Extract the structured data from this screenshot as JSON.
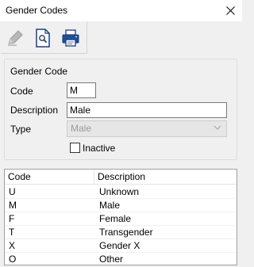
{
  "window": {
    "title": "Gender Codes",
    "close_glyph": "✕"
  },
  "toolbar": {
    "buttons": [
      {
        "name": "edit-pencil-icon"
      },
      {
        "name": "preview-document-icon"
      },
      {
        "name": "printer-icon"
      }
    ]
  },
  "form": {
    "group_title": "Gender Code",
    "code_label": "Code",
    "code_value": "M",
    "description_label": "Description",
    "description_value": "Male",
    "type_label": "Type",
    "type_value": "Male",
    "inactive_label": "Inactive",
    "inactive_checked": false
  },
  "table": {
    "columns": [
      "Code",
      "Description"
    ],
    "rows": [
      {
        "code": "U",
        "description": "Unknown"
      },
      {
        "code": "M",
        "description": "Male"
      },
      {
        "code": "F",
        "description": "Female"
      },
      {
        "code": "T",
        "description": "Transgender"
      },
      {
        "code": "X",
        "description": "Gender X"
      },
      {
        "code": "O",
        "description": "Other"
      }
    ]
  }
}
